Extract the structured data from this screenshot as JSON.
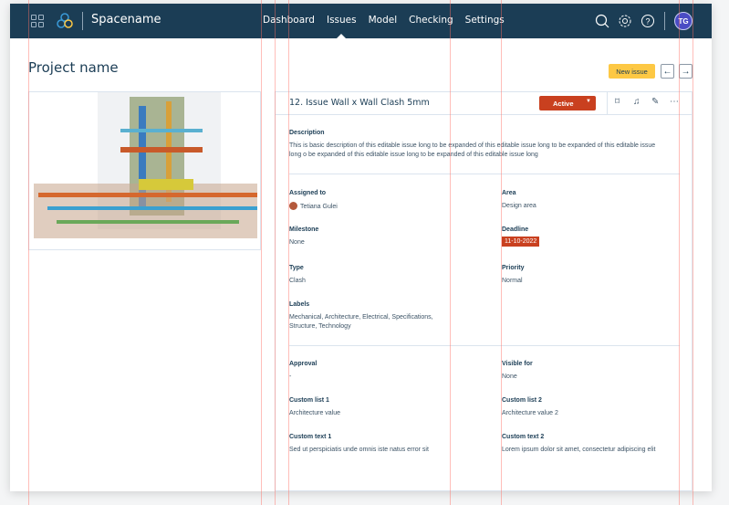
{
  "header": {
    "space_name": "Spacename",
    "nav": [
      "Dashboard",
      "Issues",
      "Model",
      "Checking",
      "Settings"
    ],
    "active_nav": "Issues",
    "avatar_initials": "TG"
  },
  "page": {
    "title": "Project name",
    "new_issue_label": "New issue"
  },
  "issue": {
    "title": "12. Issue Wall x Wall Clash 5mm",
    "status": "Active",
    "description_label": "Description",
    "description": "This is basic description of this editable issue long to be expanded of this editable issue long to be expanded of this editable issue long o be expanded of this editable issue long to be expanded of this editable issue long",
    "fields": {
      "assigned_to": {
        "label": "Assigned to",
        "value": "Tetiana Gulei"
      },
      "area": {
        "label": "Area",
        "value": "Design area"
      },
      "milestone": {
        "label": "Milestone",
        "value": "None"
      },
      "deadline": {
        "label": "Deadline",
        "value": "11-10-2022"
      },
      "type": {
        "label": "Type",
        "value": "Clash"
      },
      "priority": {
        "label": "Priority",
        "value": "Normal"
      },
      "labels": {
        "label": "Labels",
        "value": "Mechanical, Architecture, Electrical, Specifications, Structure, Technology"
      },
      "approval": {
        "label": "Approval",
        "value": "-"
      },
      "visible_for": {
        "label": "Visible for",
        "value": "None"
      },
      "custom_list_1": {
        "label": "Custom list 1",
        "value": "Architecture value"
      },
      "custom_list_2": {
        "label": "Custom list 2",
        "value": "Architecture value 2"
      },
      "custom_text_1": {
        "label": "Custom text 1",
        "value": "Sed ut perspiciatis unde omnis iste natus error sit"
      },
      "custom_text_2": {
        "label": "Custom text 2",
        "value": "Lorem ipsum dolor sit amet, consectetur adipiscing elit"
      }
    }
  },
  "colors": {
    "header": "#1b3d55",
    "accent": "#fdc844",
    "status": "#c9401f"
  }
}
